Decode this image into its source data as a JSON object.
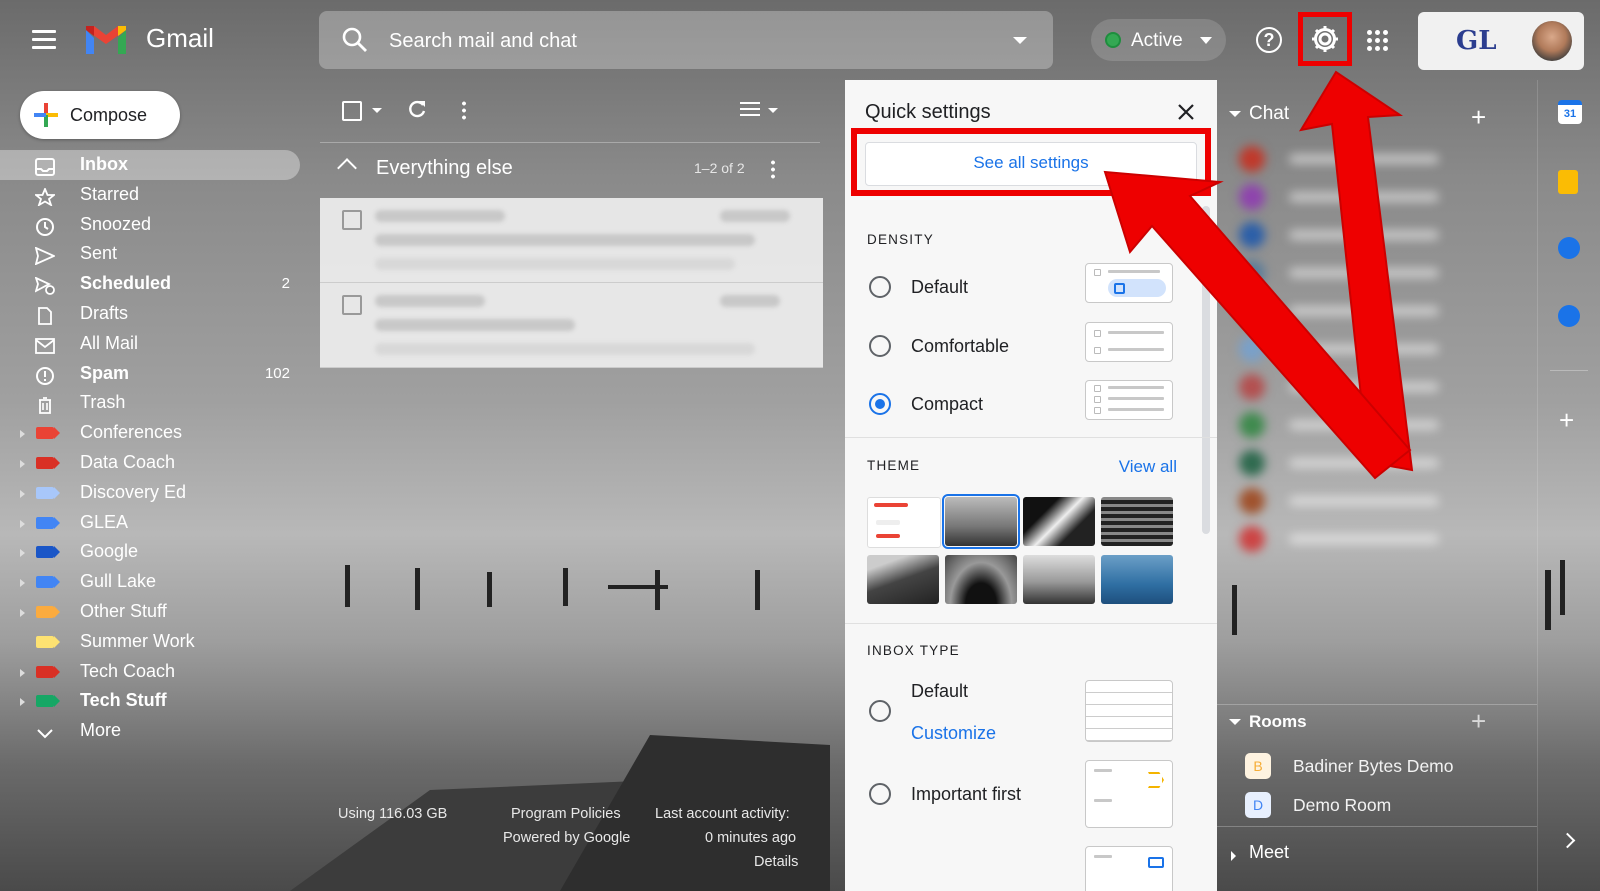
{
  "app": {
    "brand": "Gmail"
  },
  "search": {
    "placeholder": "Search mail and chat"
  },
  "status": {
    "label": "Active"
  },
  "account": {
    "org": "GL"
  },
  "compose": {
    "label": "Compose"
  },
  "nav": [
    {
      "label": "Inbox",
      "count": "",
      "selected": true,
      "bold": true,
      "icon": "inbox-icon"
    },
    {
      "label": "Starred",
      "count": "",
      "icon": "star-icon"
    },
    {
      "label": "Snoozed",
      "count": "",
      "icon": "clock-icon"
    },
    {
      "label": "Sent",
      "count": "",
      "icon": "send-icon"
    },
    {
      "label": "Scheduled",
      "count": "2",
      "bold": true,
      "icon": "scheduled-icon"
    },
    {
      "label": "Drafts",
      "count": "",
      "icon": "draft-icon"
    },
    {
      "label": "All Mail",
      "count": "",
      "icon": "mail-icon"
    },
    {
      "label": "Spam",
      "count": "102",
      "bold": true,
      "icon": "spam-icon"
    },
    {
      "label": "Trash",
      "count": "",
      "icon": "trash-icon"
    },
    {
      "label": "Conferences",
      "color": "#ea4335",
      "arrow": true
    },
    {
      "label": "Data Coach",
      "color": "#d93025",
      "arrow": true
    },
    {
      "label": "Discovery Ed",
      "color": "#a8c7fa",
      "arrow": true
    },
    {
      "label": "GLEA",
      "color": "#4285f4",
      "arrow": true
    },
    {
      "label": "Google",
      "color": "#1a56c7",
      "arrow": true
    },
    {
      "label": "Gull Lake",
      "color": "#4285f4",
      "arrow": true
    },
    {
      "label": "Other Stuff",
      "color": "#fbab3f",
      "arrow": true
    },
    {
      "label": "Summer Work",
      "color": "#fde272",
      "arrow": false
    },
    {
      "label": "Tech Coach",
      "color": "#d93025",
      "arrow": true
    },
    {
      "label": "Tech Stuff",
      "color": "#16a765",
      "arrow": true,
      "bold": true
    },
    {
      "label": "More",
      "icon": "chevron-down-icon"
    }
  ],
  "list": {
    "section_title": "Everything else",
    "range": "1–2 of 2"
  },
  "footer": {
    "storage": "Using 116.03 GB",
    "policies": "Program Policies",
    "powered": "Powered by Google",
    "activity": "Last account activity:",
    "activity_time": "0 minutes ago",
    "details": "Details"
  },
  "quick_settings": {
    "title": "Quick settings",
    "see_all": "See all settings",
    "density_header": "DENSITY",
    "density_options": [
      "Default",
      "Comfortable",
      "Compact"
    ],
    "density_selected": "Compact",
    "theme_header": "THEME",
    "view_all": "View all",
    "inbox_type_header": "INBOX TYPE",
    "inbox_default": "Default",
    "customize": "Customize",
    "important_first": "Important first"
  },
  "chat": {
    "title": "Chat",
    "rooms_title": "Rooms",
    "rooms": [
      {
        "initial": "B",
        "name": "Badiner Bytes Demo",
        "color": "#f6ad37"
      },
      {
        "initial": "D",
        "name": "Demo Room",
        "color": "#4285f4"
      }
    ],
    "meet_title": "Meet"
  },
  "rail": {
    "calendar_day": "31"
  },
  "colors": {
    "accent": "#1a73e8",
    "highlight": "#e00000"
  }
}
